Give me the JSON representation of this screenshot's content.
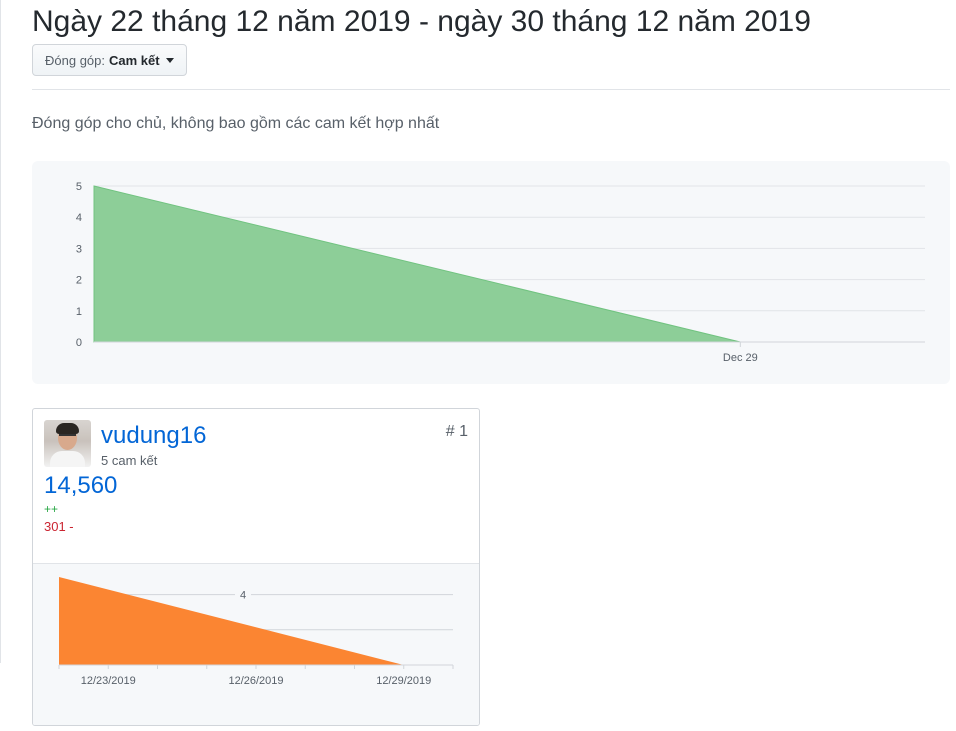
{
  "page": {
    "title": "Ngày 22 tháng 12 năm 2019 - ngày 30 tháng 12 năm 2019",
    "filter": {
      "label": "Đóng góp:",
      "value": "Cam kết"
    },
    "subtitle": "Đóng góp cho chủ, không bao gồm các cam kết hợp nhất"
  },
  "colors": {
    "main_fill": "#8dce98",
    "main_stroke": "#71c380",
    "contributor_fill": "#fb8532",
    "link": "#0366d6",
    "additions": "#28a745",
    "deletions": "#cb2431"
  },
  "chart_data": [
    {
      "type": "area",
      "title": "",
      "xlabel": "",
      "ylabel": "",
      "y_ticks": [
        "0",
        "1",
        "2",
        "3",
        "4",
        "5"
      ],
      "x_ticks": [
        "Dec 29"
      ],
      "ylim": [
        0,
        5
      ],
      "xlim": [
        "2019-12-22",
        "2019-12-31"
      ],
      "series": [
        {
          "x": [
            "2019-12-22",
            "2019-12-29"
          ],
          "values": [
            5,
            0
          ]
        }
      ],
      "grid": true
    },
    {
      "type": "area",
      "title": "",
      "x_ticks": [
        "12/23/2019",
        "12/26/2019",
        "12/29/2019"
      ],
      "grid_label": "4",
      "ylim": [
        0,
        5
      ],
      "xlim": [
        "2019-12-22",
        "2019-12-30"
      ],
      "series": [
        {
          "x": [
            "2019-12-22",
            "2019-12-29"
          ],
          "values": [
            5,
            0
          ]
        }
      ],
      "grid": true
    }
  ],
  "contributors": [
    {
      "rank": "# 1",
      "username": "vudung16",
      "commits": "5 cam kết",
      "additions_total": "14,560",
      "additions": "++",
      "deletions": "301 -"
    }
  ]
}
